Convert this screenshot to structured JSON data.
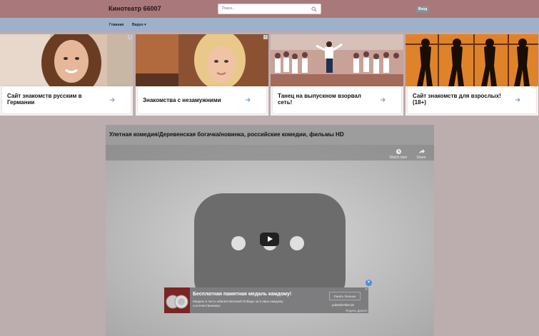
{
  "header": {
    "site_title": "Кинотеатр 66007",
    "search_placeholder": "Поиск...",
    "login_label": "Вход"
  },
  "nav": {
    "home": "Главная",
    "video": "Видео ▾"
  },
  "ads": [
    {
      "text": "Сайт знакомств русским в Германии"
    },
    {
      "text": "Знакомства с незамужними"
    },
    {
      "text": "Танец на выпускном взорвал сеть!"
    },
    {
      "text": "Сайт знакомств для взрослых! (18+)"
    }
  ],
  "video": {
    "title": "Улетная комедия/Деревенская богачка/новинка, российские комедии, фильмы HD",
    "watch_later": "Watch later",
    "share": "Share"
  },
  "bottom_ad": {
    "title": "Бесплатная памятная медаль каждому!",
    "description": "Медаль в честь юбилея Великой Победы за 0 евро каждому соотечественнику!",
    "button": "Узнать больше",
    "domain": "pobeda75let.de",
    "source": "Яндекс.Директ",
    "close": "×",
    "small_x": "✕"
  },
  "colors": {
    "topbar": "#a9787b",
    "navbar": "#9fb0c9",
    "background": "#bcadaf"
  }
}
